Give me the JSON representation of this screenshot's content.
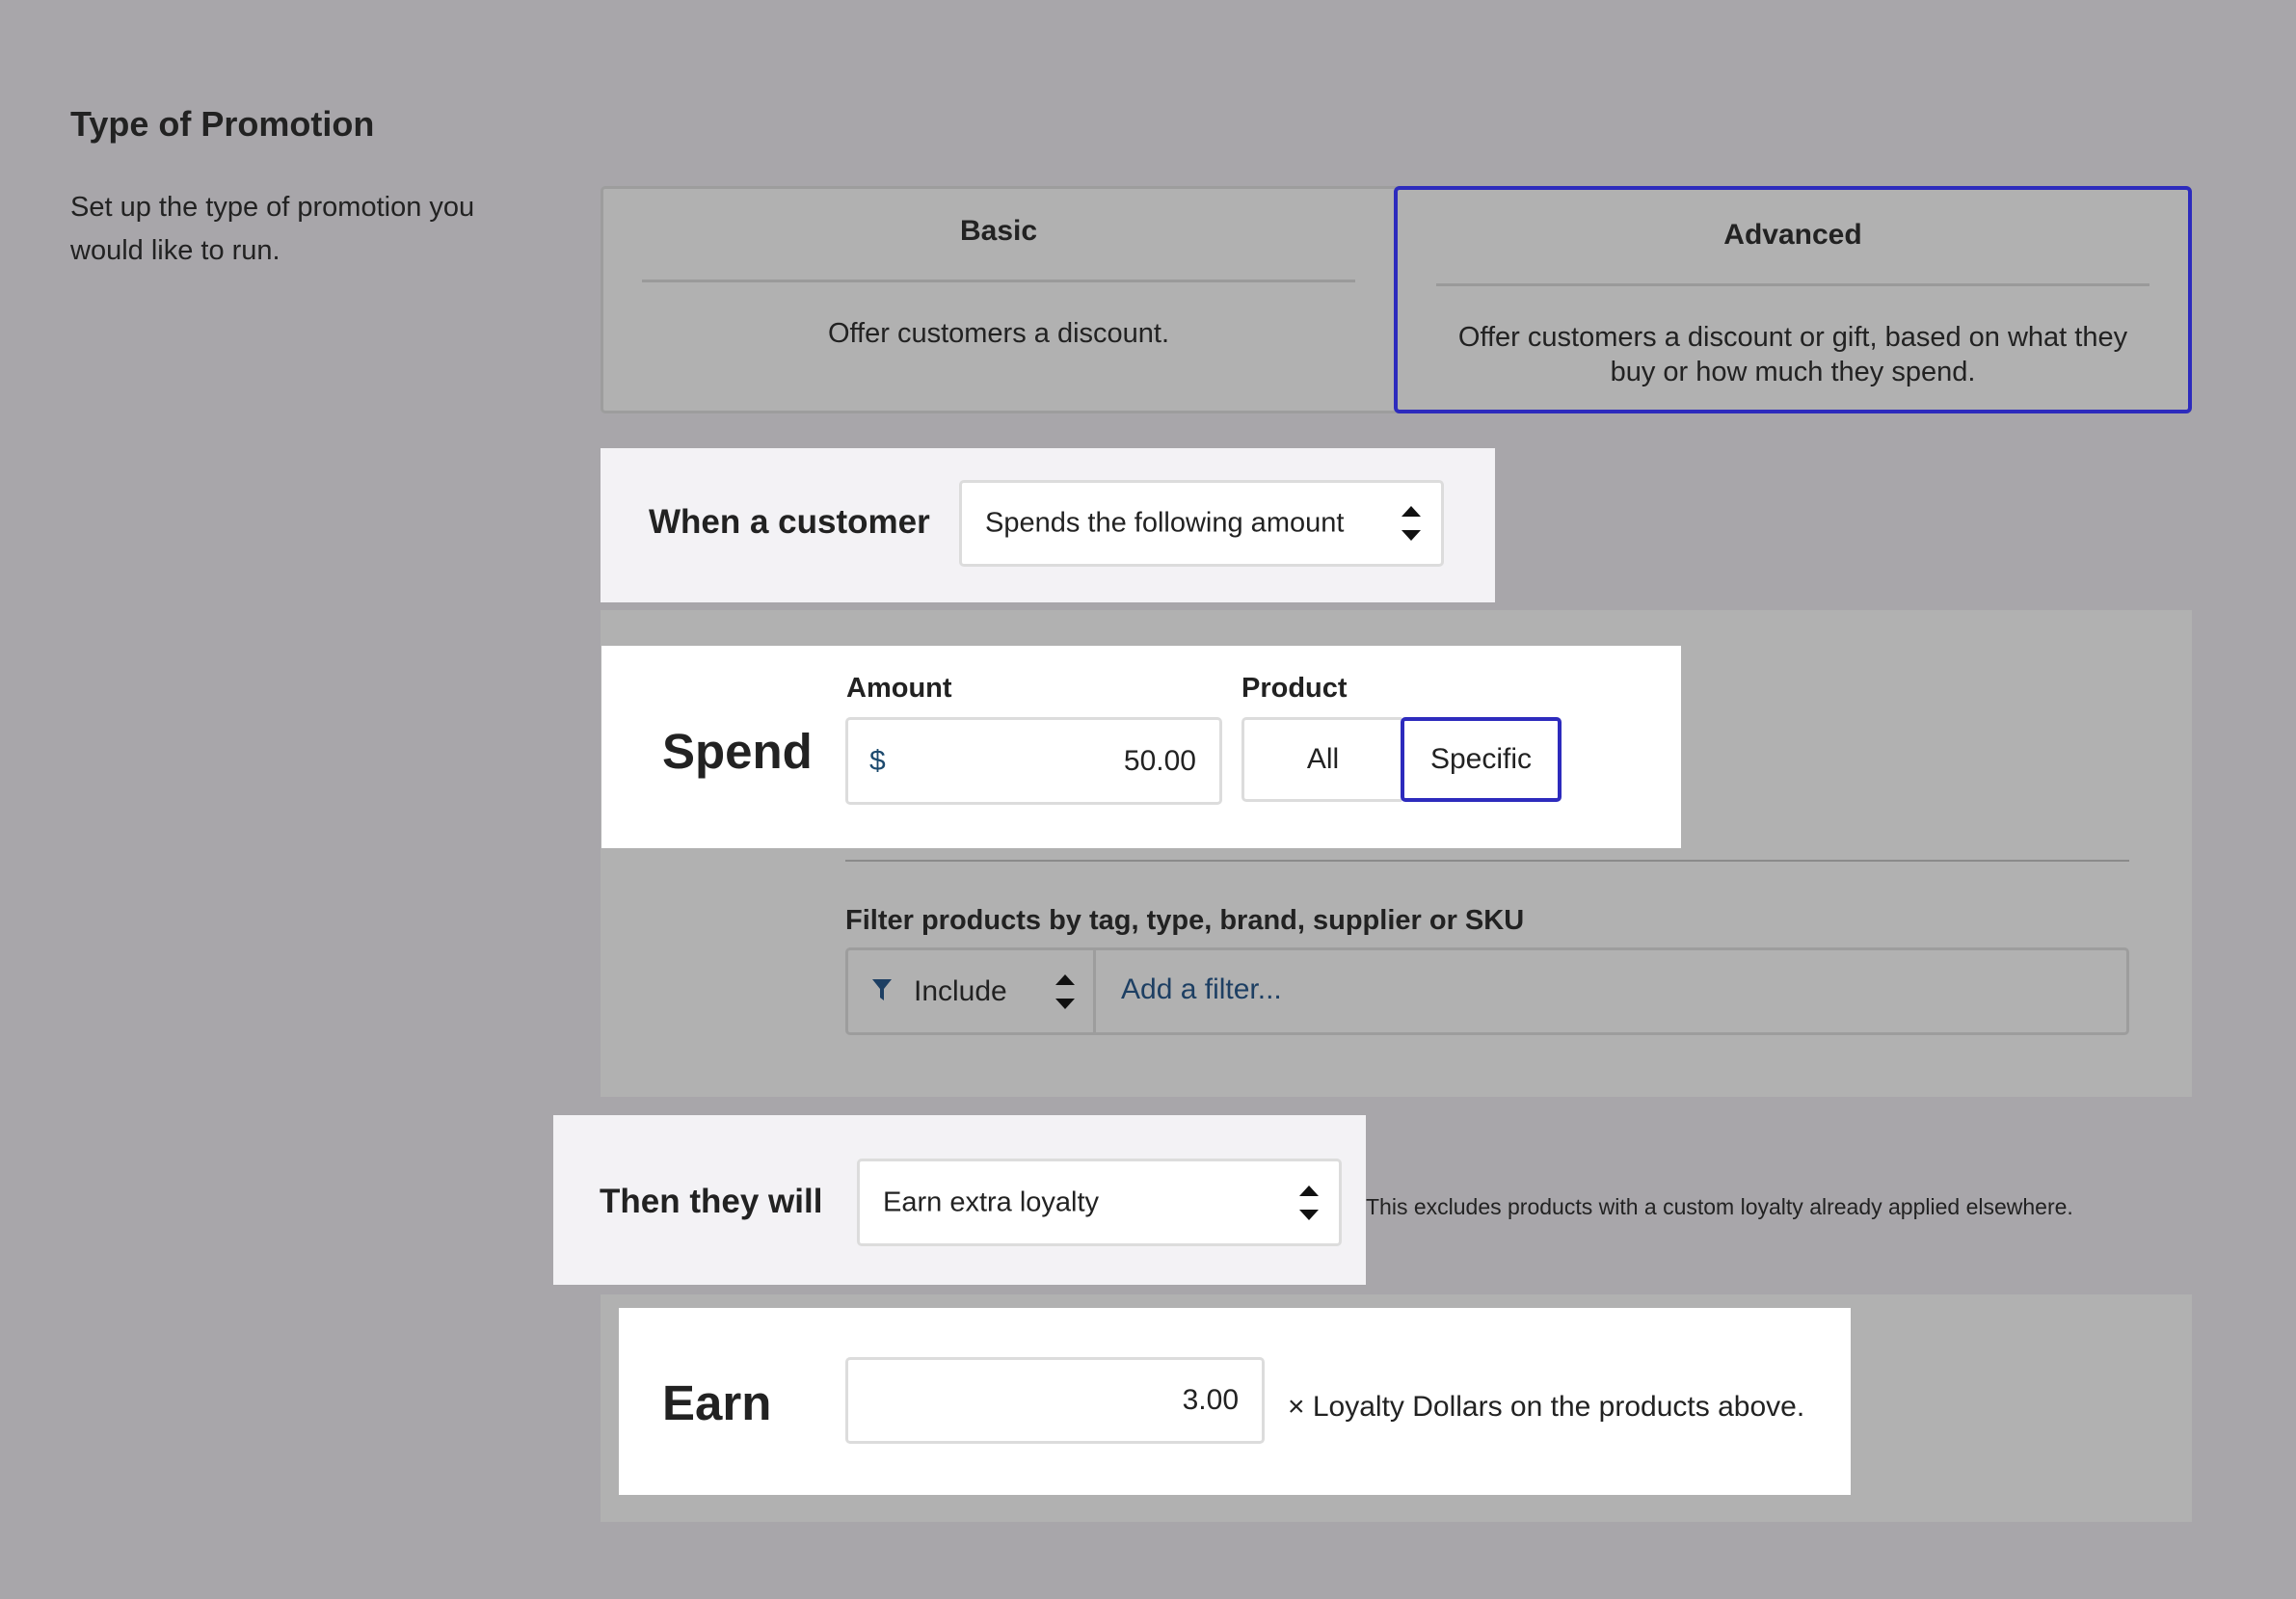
{
  "section": {
    "title": "Type of Promotion",
    "description": "Set up the type of promotion you would like to run."
  },
  "promotion_types": [
    {
      "title": "Basic",
      "description": "Offer customers a discount.",
      "selected": false
    },
    {
      "title": "Advanced",
      "description": "Offer customers a discount or gift, based on what they buy or how much they spend.",
      "selected": true
    }
  ],
  "condition": {
    "label": "When a customer",
    "select_value": "Spends the following amount"
  },
  "spend": {
    "label": "Spend",
    "amount_label": "Amount",
    "currency_prefix": "$",
    "amount_value": "50.00",
    "product_label": "Product",
    "product_options": [
      "All",
      "Specific"
    ],
    "product_selected": "Specific"
  },
  "filter": {
    "label": "Filter products by tag, type, brand, supplier or SKU",
    "mode": "Include",
    "placeholder": "Add a filter..."
  },
  "action": {
    "label": "Then they will",
    "select_value": "Earn extra loyalty",
    "hint": "This excludes products with a custom loyalty already applied elsewhere."
  },
  "earn": {
    "label": "Earn",
    "value": "3.00",
    "suffix": "× Loyalty Dollars on the products above."
  },
  "colors": {
    "background": "#a8a6aa",
    "accent": "#2d2bbd",
    "link": "#1d3f63"
  }
}
